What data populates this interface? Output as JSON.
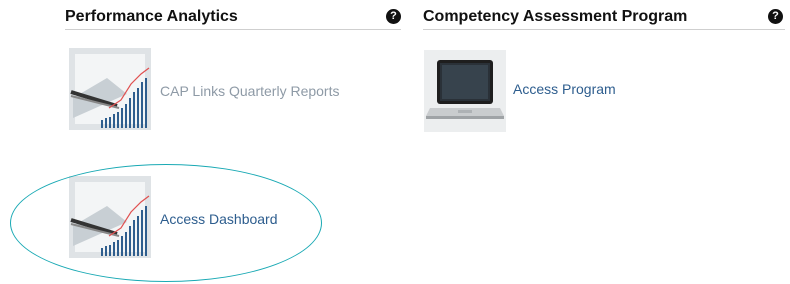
{
  "sections": {
    "performance": {
      "title": "Performance Analytics",
      "help_icon": "question-circle-icon",
      "items": [
        {
          "label": "CAP Links Quarterly Reports",
          "icon": "report-chart-pen-icon",
          "style": "muted"
        },
        {
          "label": "Access Dashboard",
          "icon": "report-chart-pen-icon",
          "style": "link"
        }
      ]
    },
    "competency": {
      "title": "Competency Assessment Program",
      "help_icon": "question-circle-icon",
      "items": [
        {
          "label": "Access Program",
          "icon": "laptop-icon",
          "style": "link"
        }
      ]
    }
  },
  "colors": {
    "link": "#2d5d8e",
    "muted": "#8e9aa6",
    "highlight": "#19a9b4"
  }
}
